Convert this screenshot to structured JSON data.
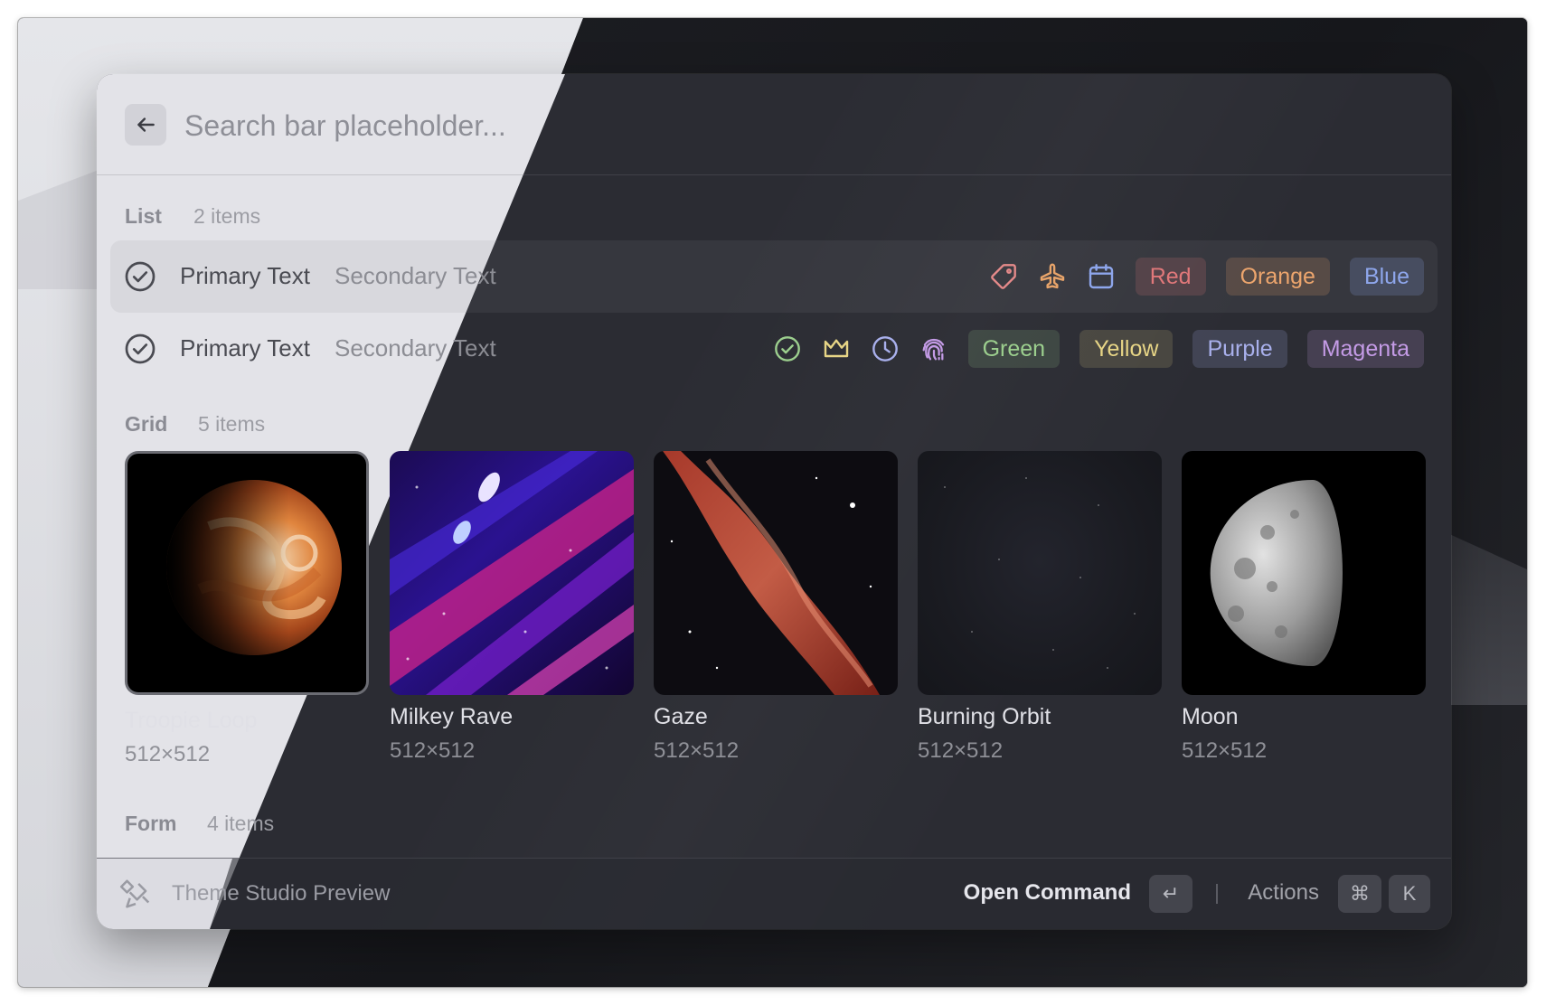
{
  "search": {
    "placeholder": "Search bar placeholder..."
  },
  "list": {
    "title": "List",
    "count": "2 items",
    "rows": [
      {
        "primary": "Primary Text",
        "secondary": "Secondary Text",
        "icons": [
          "tag-icon",
          "airplane-icon",
          "calendar-icon"
        ],
        "tags": [
          {
            "label": "Red",
            "color": "#e0787a"
          },
          {
            "label": "Orange",
            "color": "#eca56d"
          },
          {
            "label": "Blue",
            "color": "#8ea6ec"
          }
        ]
      },
      {
        "primary": "Primary Text",
        "secondary": "Secondary Text",
        "icons": [
          "check-circle-icon",
          "crown-icon",
          "clock-icon",
          "fingerprint-icon"
        ],
        "tags": [
          {
            "label": "Green",
            "color": "#9ccf8e"
          },
          {
            "label": "Yellow",
            "color": "#e7d586"
          },
          {
            "label": "Purple",
            "color": "#a9b0ec"
          },
          {
            "label": "Magenta",
            "color": "#c49be6"
          }
        ]
      }
    ]
  },
  "grid": {
    "title": "Grid",
    "count": "5 items",
    "items": [
      {
        "title": "Troopie Loop",
        "subtitle": "512×512"
      },
      {
        "title": "Milkey Rave",
        "subtitle": "512×512"
      },
      {
        "title": "Gaze",
        "subtitle": "512×512"
      },
      {
        "title": "Burning Orbit",
        "subtitle": "512×512"
      },
      {
        "title": "Moon",
        "subtitle": "512×512"
      }
    ]
  },
  "form": {
    "title": "Form",
    "count": "4 items"
  },
  "footer": {
    "title": "Theme Studio Preview",
    "primary_action": "Open Command",
    "enter_key": "↵",
    "actions_label": "Actions",
    "cmd_key": "⌘",
    "k_key": "K"
  },
  "colors": {
    "icon_tag": "#e58a8a",
    "icon_airplane": "#e8a46a",
    "icon_calendar": "#8ea6ec",
    "icon_check": "#9ccf8e",
    "icon_crown": "#e7d586",
    "icon_clock": "#a9b0ec",
    "icon_fingerprint": "#c49be6"
  }
}
